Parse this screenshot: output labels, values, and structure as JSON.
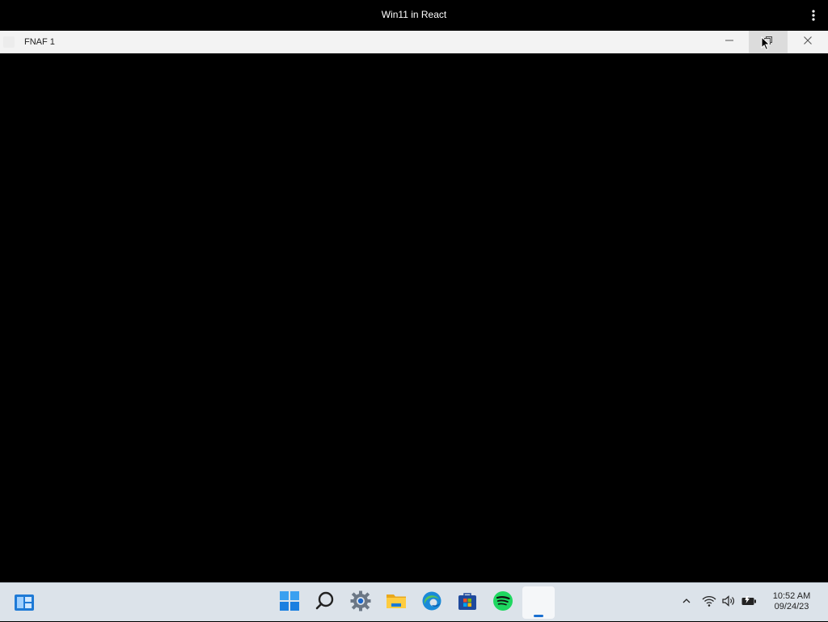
{
  "browser": {
    "title": "Win11 in React",
    "menu_icon": "kebab-menu-icon"
  },
  "window": {
    "title": "FNAF 1",
    "buttons": {
      "minimize_icon": "minimize-icon",
      "restore_icon": "restore-icon",
      "close_icon": "close-icon"
    }
  },
  "taskbar": {
    "widgets_icon": "widgets-icon",
    "items": [
      {
        "name": "Start",
        "icon": "windows-start-icon"
      },
      {
        "name": "Search",
        "icon": "search-icon"
      },
      {
        "name": "Settings",
        "icon": "settings-gear-icon"
      },
      {
        "name": "File Explorer",
        "icon": "folder-icon"
      },
      {
        "name": "Edge",
        "icon": "edge-browser-icon"
      },
      {
        "name": "Store",
        "icon": "store-icon"
      },
      {
        "name": "Spotify",
        "icon": "spotify-icon"
      },
      {
        "name": "FNAF 1",
        "icon": "blank-app-icon",
        "active": true
      }
    ],
    "tray": {
      "chevron_icon": "chevron-up-icon",
      "wifi_icon": "wifi-icon",
      "volume_icon": "volume-icon",
      "battery_icon": "battery-icon"
    },
    "clock": {
      "time": "10:52 AM",
      "date": "09/24/23"
    }
  },
  "colors": {
    "taskbar_bg": "#dce3ea",
    "titlebar_bg": "#f3f3f3",
    "accent": "#1a6fd0"
  }
}
